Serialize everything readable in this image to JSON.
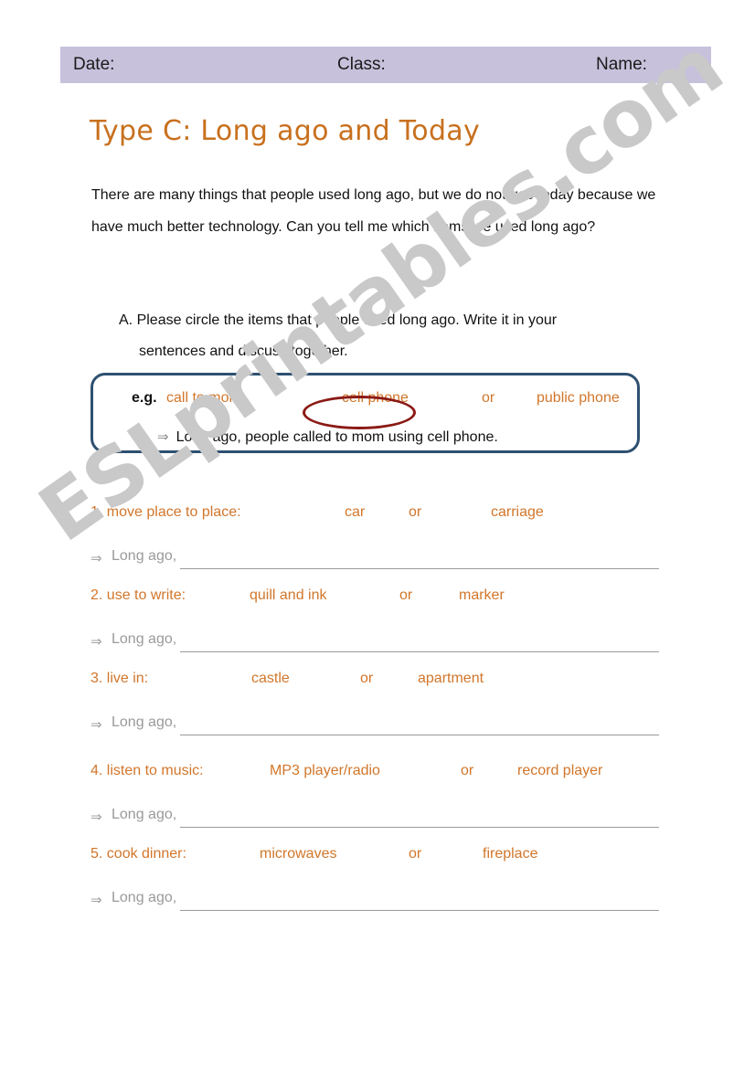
{
  "header": {
    "date_label": "Date:",
    "class_label": "Class:",
    "name_label": "Name:",
    "background_color": "#C7C1DC"
  },
  "title": "Type C: Long ago and Today",
  "title_color": "#C8701E",
  "intro": "There are many things that people used long ago, but we do not use today because we have much better technology. Can you tell me which items we used long ago?",
  "instruction": {
    "lead": "A. Please circle the items that people used long ago. Write it in your",
    "continuation": "sentences and discuss together."
  },
  "example": {
    "label": "e.g.",
    "prompt": "call to mom:",
    "option_a": "cell phone",
    "or_label": "or",
    "option_b": "public phone",
    "circled_option": "cell phone",
    "circle_color": "#8B1A15",
    "border_color": "#2E5070",
    "answer_arrow": "⇒",
    "answer_text": "Long ago, people called to mom using cell phone."
  },
  "answer_prefix": {
    "arrow": "⇒",
    "label": "Long ago,"
  },
  "or_label": "or",
  "item_color": "#D2762A",
  "items": [
    {
      "number": "1.",
      "prompt": "1. move place to place:",
      "option_a": "car",
      "or_label": "or",
      "option_b": "carriage"
    },
    {
      "number": "2.",
      "prompt": "2. use to write:",
      "option_a": "quill and ink",
      "or_label": "or",
      "option_b": "marker"
    },
    {
      "number": "3.",
      "prompt": "3. live in:",
      "option_a": "castle",
      "or_label": "or",
      "option_b": "apartment"
    },
    {
      "number": "4.",
      "prompt": "4. listen to music:",
      "option_a": "MP3 player/radio",
      "or_label": "or",
      "option_b": "record player"
    },
    {
      "number": "5.",
      "prompt": "5. cook dinner:",
      "option_a": "microwaves",
      "or_label": "or",
      "option_b": "fireplace"
    }
  ],
  "watermark": "ESLprintables.com"
}
